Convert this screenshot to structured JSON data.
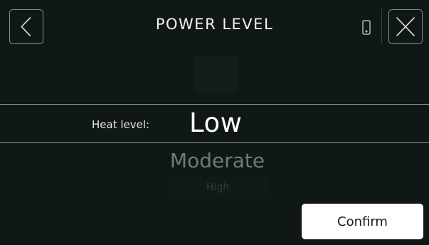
{
  "header": {
    "title": "POWER LEVEL",
    "back_icon": "chevron-left-icon",
    "close_icon": "close-icon",
    "device_icon": "phone-icon"
  },
  "picker": {
    "label": "Heat level:",
    "selected": "Low",
    "options_below": [
      "Moderate",
      "High"
    ]
  },
  "actions": {
    "confirm_label": "Confirm"
  },
  "colors": {
    "background": "#101816",
    "text": "#ffffff",
    "dim_text": "#727876",
    "button_bg": "#ffffff",
    "button_text": "#141a18"
  }
}
